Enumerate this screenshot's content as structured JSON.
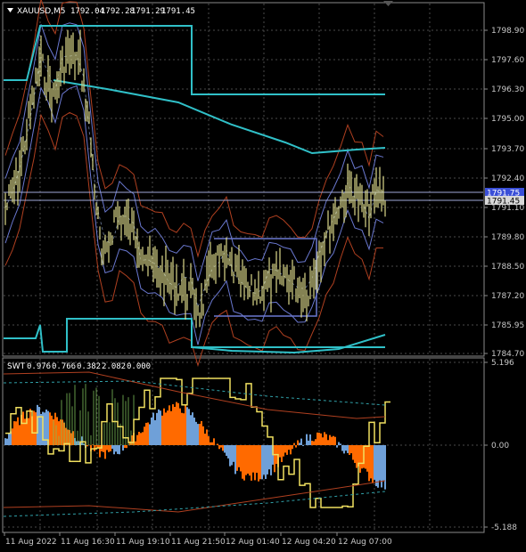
{
  "main_chart": {
    "title": "XAUUSD,M5",
    "ohlc": [
      "1792.04",
      "1792.28",
      "1791.29",
      "1791.45"
    ],
    "price_ticks": [
      "1798.90",
      "1797.60",
      "1796.30",
      "1795.00",
      "1793.70",
      "1792.40",
      "1791.10",
      "1789.80",
      "1788.50",
      "1787.20",
      "1785.95",
      "1784.70"
    ],
    "price_tags": {
      "upper": "1791.75",
      "current": "1791.45"
    },
    "dropdown_icon": "triangle-down-icon"
  },
  "sub_chart": {
    "title": "SWT",
    "values": [
      "0.976",
      "0.766",
      "0.382",
      "2.082",
      "0.000"
    ],
    "scale_ticks": [
      "5.196",
      "0.00",
      "-5.188"
    ]
  },
  "time_axis": {
    "labels": [
      "11 Aug 2022",
      "11 Aug 16:30",
      "11 Aug 19:10",
      "11 Aug 21:50",
      "12 Aug 01:40",
      "12 Aug 04:20",
      "12 Aug 07:00"
    ]
  },
  "colors": {
    "background": "#000000",
    "grid": "#4a4a4a",
    "frame": "#8a8a8a",
    "price_series": "#dcd98a",
    "cyan_band": "#30c0c8",
    "blue_band": "#6a78d0",
    "red_band": "#b04020",
    "orange_fill": "#ff6a00",
    "blue_fill": "#6fa0d8",
    "yellow_line": "#f0e060",
    "green_hatch": "#7fc05a"
  }
}
